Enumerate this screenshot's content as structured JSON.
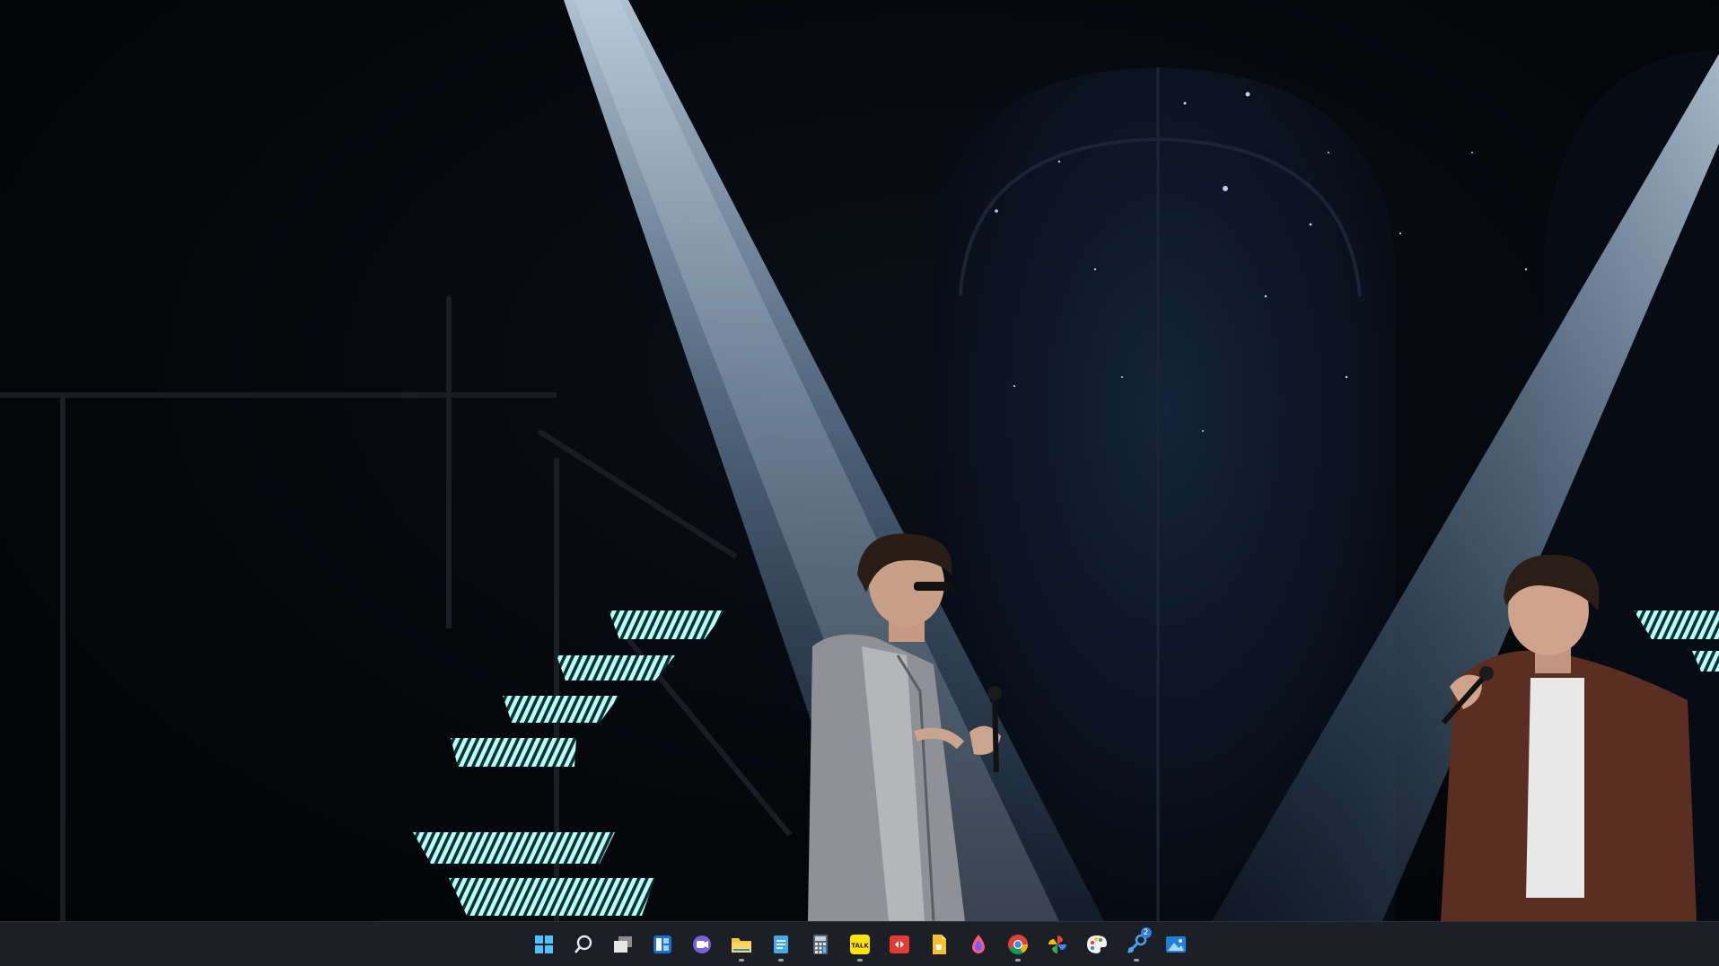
{
  "window": {
    "title": ""
  },
  "taskbar": {
    "items": [
      {
        "name": "start-button",
        "icon": "windows-logo-icon",
        "running": false
      },
      {
        "name": "search-button",
        "icon": "search-icon",
        "running": false
      },
      {
        "name": "task-view-button",
        "icon": "task-view-icon",
        "running": false
      },
      {
        "name": "widgets-button",
        "icon": "widgets-icon",
        "running": false
      },
      {
        "name": "teams-chat-button",
        "icon": "chat-camera-icon",
        "running": false
      },
      {
        "name": "file-explorer-button",
        "icon": "folder-icon",
        "running": true
      },
      {
        "name": "notepad-button",
        "icon": "notepad-icon",
        "running": true
      },
      {
        "name": "calculator-button",
        "icon": "calculator-icon",
        "running": false
      },
      {
        "name": "kakaotalk-button",
        "icon": "kakaotalk-icon",
        "label": "TALK",
        "running": true
      },
      {
        "name": "remote-app-button",
        "icon": "red-arrows-icon",
        "running": false
      },
      {
        "name": "document-app-button",
        "icon": "yellow-document-icon",
        "running": false
      },
      {
        "name": "drop-app-button",
        "icon": "color-drop-icon",
        "running": false
      },
      {
        "name": "chrome-button",
        "icon": "chrome-icon",
        "running": true
      },
      {
        "name": "photos-pinwheel-button",
        "icon": "pinwheel-icon",
        "running": false
      },
      {
        "name": "paint-button",
        "icon": "paint-palette-icon",
        "running": false
      },
      {
        "name": "steam-button",
        "icon": "steam-icon",
        "badge": "2",
        "running": true
      },
      {
        "name": "photos-button",
        "icon": "image-icon",
        "running": false
      }
    ]
  },
  "colors": {
    "taskbar_bg": "#1c1f26",
    "spotlight": "#bfe0ff",
    "stair_light": "#8ff3f0"
  }
}
